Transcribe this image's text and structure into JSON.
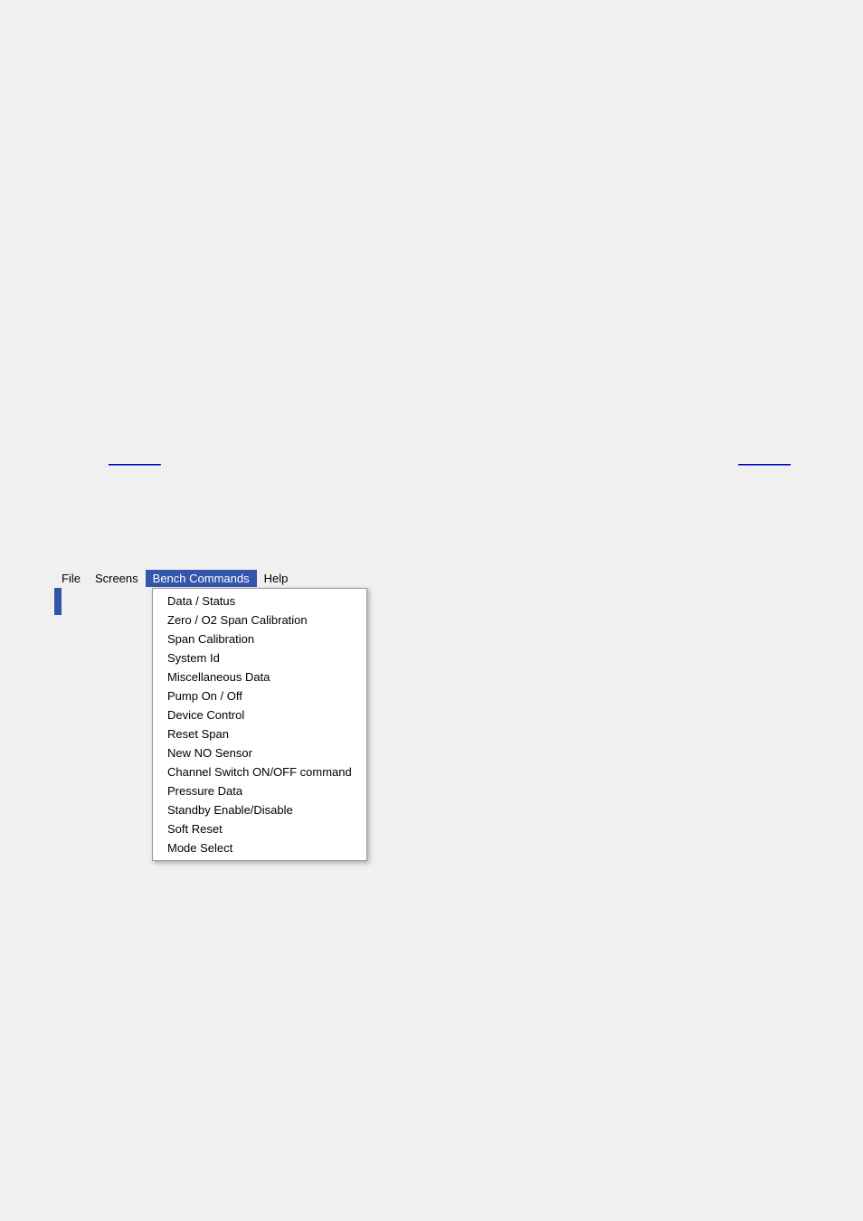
{
  "menubar": {
    "items": [
      {
        "id": "file",
        "label": "File",
        "active": false
      },
      {
        "id": "screens",
        "label": "Screens",
        "active": false
      },
      {
        "id": "bench-commands",
        "label": "Bench Commands",
        "active": true
      },
      {
        "id": "help",
        "label": "Help",
        "active": false
      }
    ]
  },
  "dropdown": {
    "items": [
      {
        "id": "data-status",
        "label": "Data / Status"
      },
      {
        "id": "zero-o2-span",
        "label": "Zero / O2 Span Calibration"
      },
      {
        "id": "span-calibration",
        "label": "Span Calibration"
      },
      {
        "id": "system-id",
        "label": "System Id"
      },
      {
        "id": "miscellaneous-data",
        "label": "Miscellaneous Data"
      },
      {
        "id": "pump-on-off",
        "label": "Pump On / Off"
      },
      {
        "id": "device-control",
        "label": "Device Control"
      },
      {
        "id": "reset-span",
        "label": "Reset Span"
      },
      {
        "id": "new-no-sensor",
        "label": "New NO Sensor"
      },
      {
        "id": "channel-switch",
        "label": "Channel Switch ON/OFF command"
      },
      {
        "id": "pressure-data",
        "label": "Pressure Data"
      },
      {
        "id": "standby-enable",
        "label": "Standby Enable/Disable"
      },
      {
        "id": "soft-reset",
        "label": "Soft Reset"
      },
      {
        "id": "mode-select",
        "label": "Mode Select"
      }
    ]
  },
  "links": {
    "left": "________",
    "right": "________"
  }
}
